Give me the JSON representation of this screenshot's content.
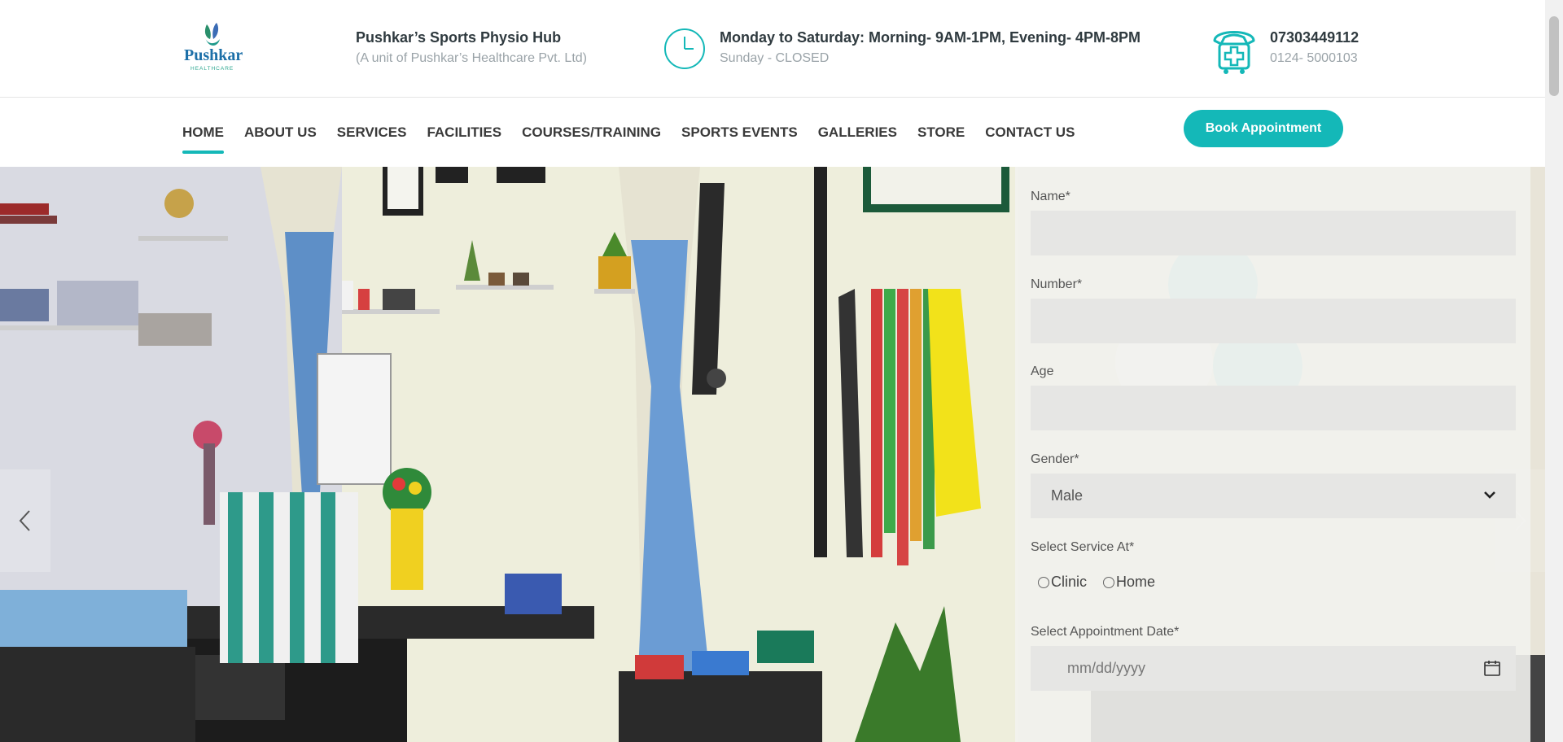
{
  "brand": {
    "logo_text": "Pushkar",
    "logo_subtext": "HEALTHCARE",
    "name": "Pushkar’s Sports Physio Hub",
    "subtitle": "(A unit of Pushkar’s Healthcare Pvt. Ltd)"
  },
  "hours": {
    "icon": "clock-icon",
    "weekday": "Monday to Saturday: Morning- 9AM-1PM, Evening- 4PM-8PM",
    "sunday": "Sunday - CLOSED"
  },
  "contact": {
    "icon": "medical-phone-icon",
    "mobile": "07303449112",
    "landline": "0124- 5000103"
  },
  "nav": {
    "items": [
      {
        "label": "HOME",
        "active": true
      },
      {
        "label": "ABOUT US"
      },
      {
        "label": "SERVICES"
      },
      {
        "label": "FACILITIES"
      },
      {
        "label": "COURSES/TRAINING"
      },
      {
        "label": "SPORTS EVENTS"
      },
      {
        "label": "GALLERIES"
      },
      {
        "label": "STORE"
      },
      {
        "label": "CONTACT US"
      }
    ],
    "book_button": "Book Appointment"
  },
  "form": {
    "name_label": "Name*",
    "number_label": "Number*",
    "age_label": "Age",
    "gender_label": "Gender*",
    "gender_value": "Male",
    "service_label": "Select Service At*",
    "service_options": [
      "Clinic",
      "Home"
    ],
    "date_label": "Select Appointment Date*",
    "date_placeholder": "mm/dd/yyyy"
  },
  "colors": {
    "accent": "#14b8b8",
    "nav_text": "#3a3a3a",
    "muted_text": "#9aa3a8"
  }
}
